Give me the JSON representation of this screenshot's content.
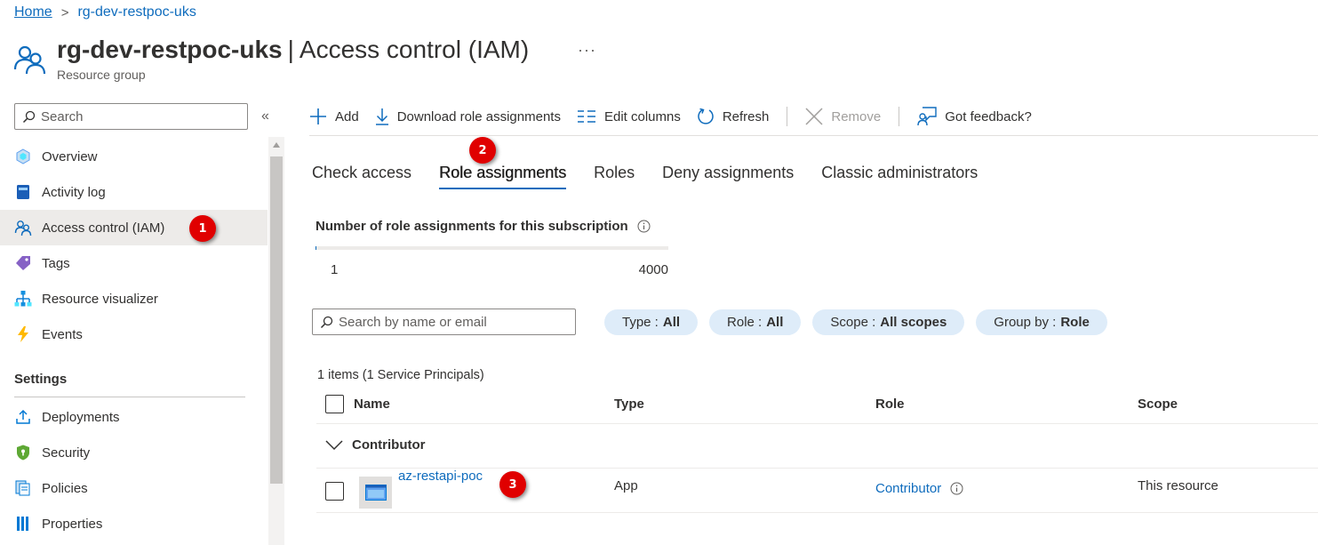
{
  "breadcrumb": {
    "home": "Home",
    "separator": ">",
    "current": "rg-dev-restpoc-uks"
  },
  "header": {
    "resource_name": "rg-dev-restpoc-uks",
    "separator": "|",
    "page_name": "Access control (IAM)",
    "subtitle": "Resource group",
    "more": "···",
    "icon": "users-icon"
  },
  "sidebar": {
    "search_placeholder": "Search",
    "collapse": "«",
    "items": [
      {
        "label": "Overview",
        "icon": "overview-icon"
      },
      {
        "label": "Activity log",
        "icon": "activity-log-icon"
      },
      {
        "label": "Access control (IAM)",
        "icon": "iam-icon",
        "active": true
      },
      {
        "label": "Tags",
        "icon": "tag-icon"
      },
      {
        "label": "Resource visualizer",
        "icon": "visualizer-icon"
      },
      {
        "label": "Events",
        "icon": "lightning-icon"
      }
    ],
    "section_settings": "Settings",
    "settings_items": [
      {
        "label": "Deployments",
        "icon": "upload-icon"
      },
      {
        "label": "Security",
        "icon": "shield-icon"
      },
      {
        "label": "Policies",
        "icon": "policy-icon"
      },
      {
        "label": "Properties",
        "icon": "properties-icon"
      }
    ]
  },
  "toolbar": {
    "add": "Add",
    "download": "Download role assignments",
    "edit_columns": "Edit columns",
    "refresh": "Refresh",
    "remove": "Remove",
    "feedback": "Got feedback?"
  },
  "tabs": [
    "Check access",
    "Role assignments",
    "Roles",
    "Deny assignments",
    "Classic administrators"
  ],
  "active_tab": "Role assignments",
  "counter": {
    "label": "Number of role assignments for this subscription",
    "current": "1",
    "max": "4000",
    "fraction": 0.00025
  },
  "filters": {
    "search_placeholder": "Search by name or email",
    "type": {
      "label": "Type :",
      "value": "All"
    },
    "role": {
      "label": "Role :",
      "value": "All"
    },
    "scope": {
      "label": "Scope :",
      "value": "All scopes"
    },
    "group_by": {
      "label": "Group by :",
      "value": "Role"
    }
  },
  "table": {
    "count_text": "1 items (1 Service Principals)",
    "columns": [
      "Name",
      "Type",
      "Role",
      "Scope"
    ],
    "group": "Contributor",
    "rows": [
      {
        "name": "az-restapi-poc",
        "type": "App",
        "role": "Contributor",
        "scope": "This resource"
      }
    ]
  },
  "annotations": [
    "1",
    "2",
    "3"
  ],
  "colors": {
    "accent": "#0f6cbd",
    "pill_bg": "#deecf9",
    "badge": "#e00000",
    "active_bg": "#edebe9"
  }
}
